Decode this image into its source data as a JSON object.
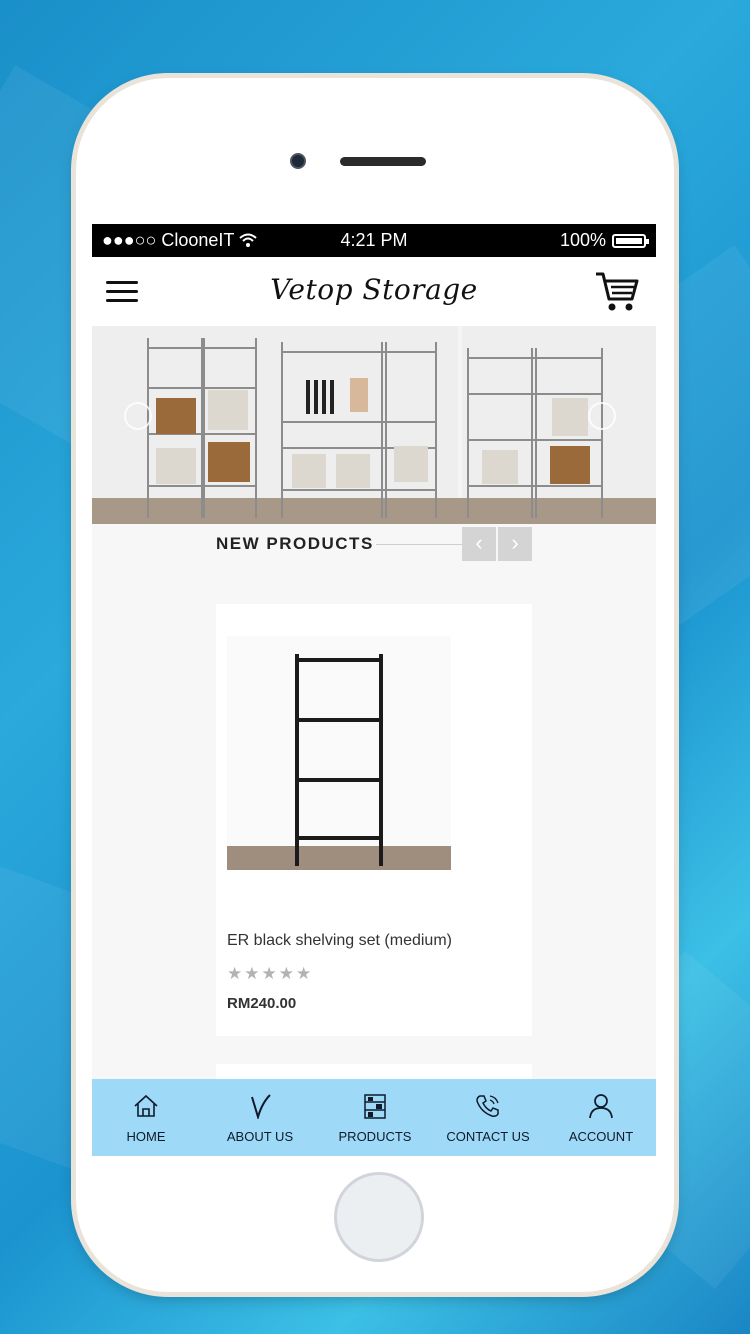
{
  "status_bar": {
    "carrier": "●●●○○ ClooneIT",
    "time": "4:21 PM",
    "battery": "100%"
  },
  "header": {
    "brand": "Vetop Storage"
  },
  "section": {
    "title": "NEW PRODUCTS",
    "prev": "‹",
    "next": "›"
  },
  "product": {
    "name": "ER black shelving set (medium)",
    "rating": 0,
    "stars": "★★★★★",
    "price": "RM240.00"
  },
  "tabs": [
    {
      "label": "HOME",
      "icon": "home-icon"
    },
    {
      "label": "ABOUT US",
      "icon": "about-icon"
    },
    {
      "label": "PRODUCTS",
      "icon": "shelf-icon"
    },
    {
      "label": "CONTACT US",
      "icon": "phone-icon"
    },
    {
      "label": "ACCOUNT",
      "icon": "user-icon"
    }
  ],
  "colors": {
    "tab_bar": "#9ed9f7",
    "status_bar": "#000000",
    "background": "#1a8fc9"
  }
}
